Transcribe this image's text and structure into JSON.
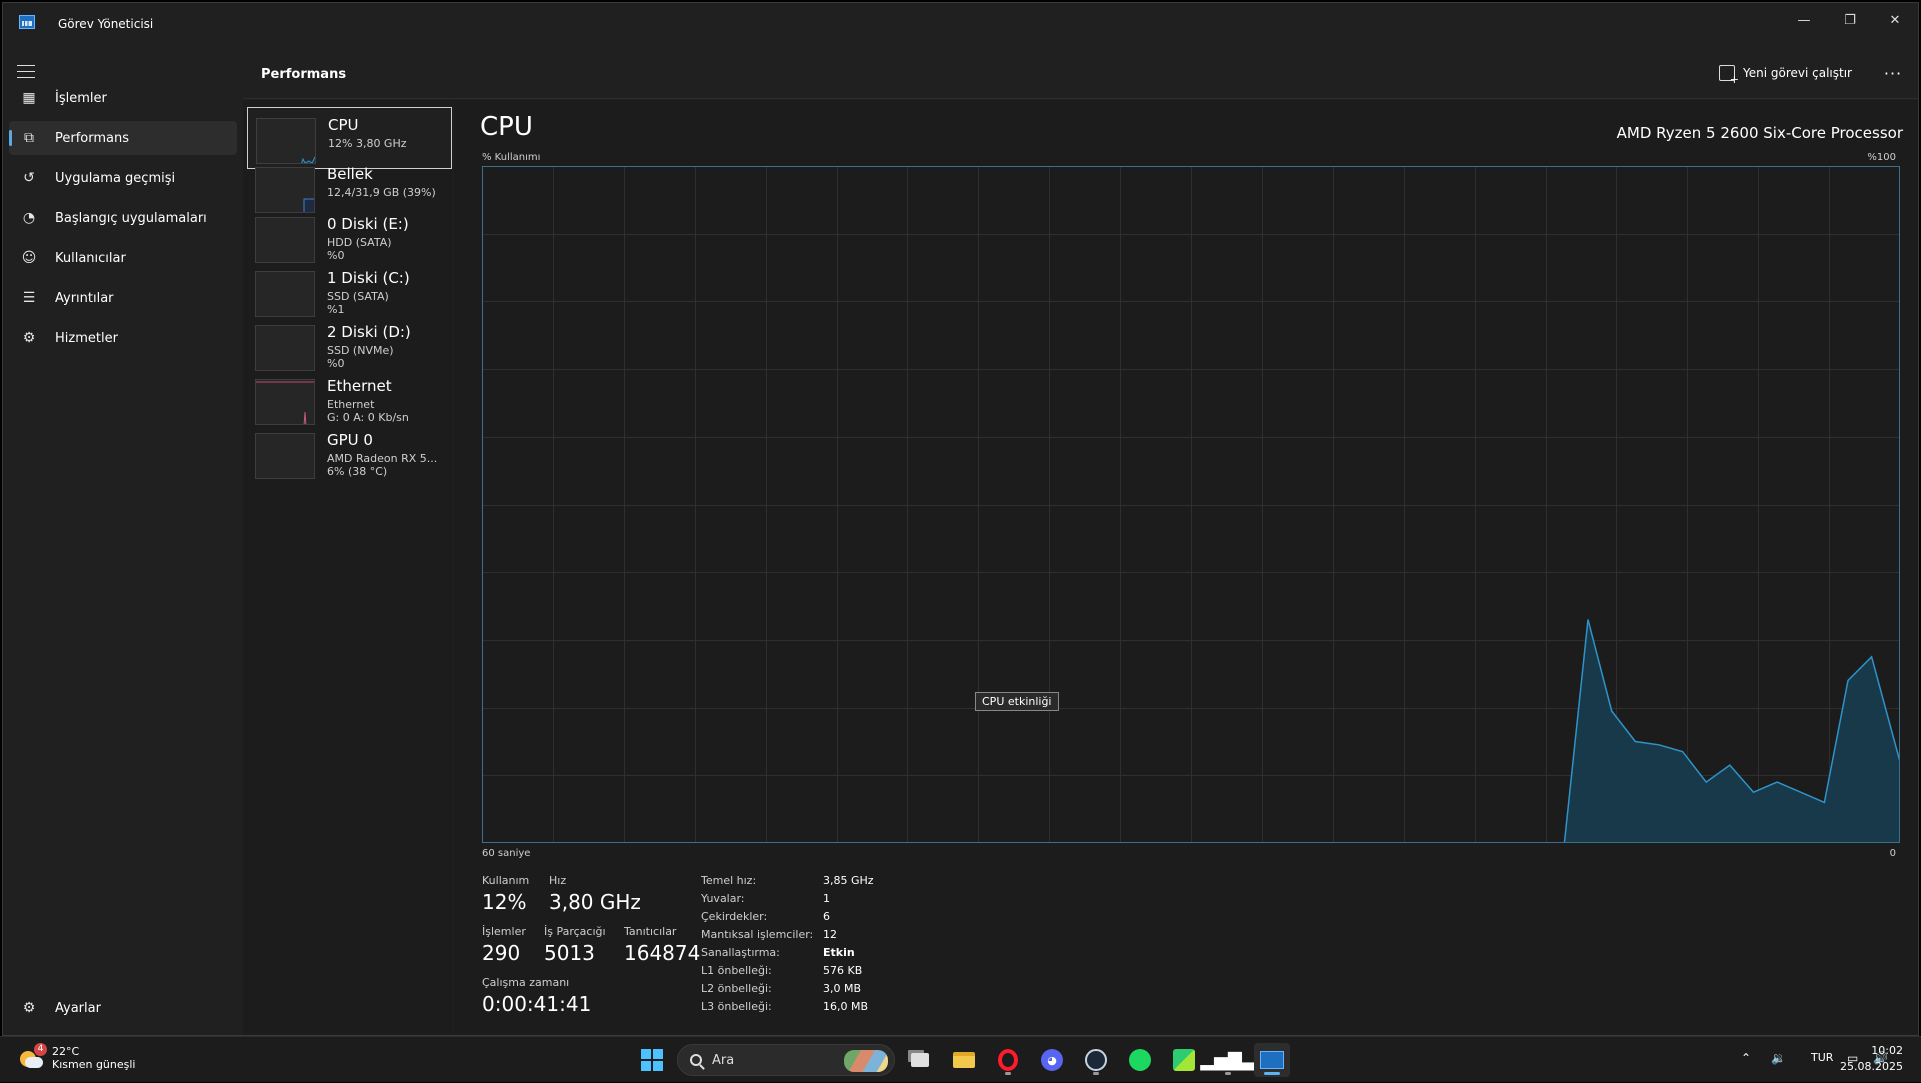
{
  "window": {
    "title": "Görev Yöneticisi"
  },
  "sidebar": {
    "items": [
      {
        "label": "İşlemler",
        "icon": "processes-icon"
      },
      {
        "label": "Performans",
        "icon": "performance-icon",
        "active": true
      },
      {
        "label": "Uygulama geçmişi",
        "icon": "history-icon"
      },
      {
        "label": "Başlangıç uygulamaları",
        "icon": "startup-icon"
      },
      {
        "label": "Kullanıcılar",
        "icon": "users-icon"
      },
      {
        "label": "Ayrıntılar",
        "icon": "details-icon"
      },
      {
        "label": "Hizmetler",
        "icon": "services-icon"
      }
    ],
    "settings_label": "Ayarlar"
  },
  "header": {
    "title": "Performans",
    "run_task_label": "Yeni görevi çalıştır",
    "more_label": "···"
  },
  "devices": [
    {
      "name": "CPU",
      "line1": "12% 3,80 GHz",
      "line2": "",
      "active": true
    },
    {
      "name": "Bellek",
      "line1": "12,4/31,9 GB (39%)",
      "line2": ""
    },
    {
      "name": "0 Diski (E:)",
      "line1": "HDD (SATA)",
      "line2": "%0"
    },
    {
      "name": "1 Diski (C:)",
      "line1": "SSD (SATA)",
      "line2": "%1"
    },
    {
      "name": "2 Diski (D:)",
      "line1": "SSD (NVMe)",
      "line2": "%0"
    },
    {
      "name": "Ethernet",
      "line1": "Ethernet",
      "line2": "G: 0 A: 0 Kb/sn"
    },
    {
      "name": "GPU 0",
      "line1": "AMD Radeon RX 5...",
      "line2": "6% (38 °C)"
    }
  ],
  "cpu": {
    "title": "CPU",
    "model": "AMD Ryzen 5 2600 Six-Core Processor",
    "usage_axis_label": "% Kullanımı",
    "max_label": "%100",
    "xaxis_left": "60 saniye",
    "xaxis_right": "0",
    "tooltip": "CPU etkinliği",
    "colors": {
      "line": "#2f93c9",
      "fill": "#17394a",
      "grid": "#2f2f2f",
      "border": "#3c6f8e"
    },
    "stats": {
      "usage_label": "Kullanım",
      "usage_value": "12%",
      "speed_label": "Hız",
      "speed_value": "3,80 GHz",
      "processes_label": "İşlemler",
      "processes_value": "290",
      "threads_label": "İş Parçacığı",
      "threads_value": "5013",
      "handles_label": "Tanıtıcılar",
      "handles_value": "164874",
      "uptime_label": "Çalışma zamanı",
      "uptime_value": "0:00:41:41"
    },
    "specs": [
      {
        "key": "Temel hız:",
        "value": "3,85 GHz"
      },
      {
        "key": "Yuvalar:",
        "value": "1"
      },
      {
        "key": "Çekirdekler:",
        "value": "6"
      },
      {
        "key": "Mantıksal işlemciler:",
        "value": "12"
      },
      {
        "key": "Sanallaştırma:",
        "value": "Etkin"
      },
      {
        "key": "L1 önbelleği:",
        "value": "576 KB"
      },
      {
        "key": "L2 önbelleği:",
        "value": "3,0 MB"
      },
      {
        "key": "L3 önbelleği:",
        "value": "16,0 MB"
      }
    ]
  },
  "chart_data": {
    "type": "area",
    "title": "CPU",
    "xlabel": "60 saniye",
    "ylabel": "% Kullanımı",
    "x_seconds_ago": [
      16,
      15,
      14,
      13,
      12,
      11,
      10,
      9,
      8,
      7,
      6,
      5,
      4,
      3,
      2,
      1,
      0
    ],
    "values": [
      0,
      33,
      19.5,
      15,
      14.5,
      13.5,
      9,
      11.5,
      7.5,
      9,
      7.5,
      6,
      24,
      27.5,
      12
    ],
    "value_x_seconds_ago": [
      14.2,
      13.2,
      12.2,
      11.2,
      10.2,
      9.2,
      8.2,
      7.2,
      6.2,
      5.2,
      4.2,
      3.2,
      2.2,
      1.2,
      0
    ],
    "xlim": [
      60,
      0
    ],
    "ylim": [
      0,
      100
    ],
    "grid": true,
    "grid_cols": 20,
    "grid_rows": 10
  },
  "taskbar": {
    "weather_temp": "22°C",
    "weather_desc": "Kısmen güneşli",
    "weather_badge": "4",
    "search_label": "Ara",
    "apps": [
      "start-icon",
      "search",
      "task-view-icon",
      "file-explorer-icon",
      "opera-icon",
      "discord-icon",
      "steam-icon",
      "spotify-icon",
      "app-green-icon",
      "audio-graph-icon",
      "task-manager-icon"
    ],
    "tray_lang": "TUR",
    "time": "10:02",
    "date": "25.08.2025"
  }
}
